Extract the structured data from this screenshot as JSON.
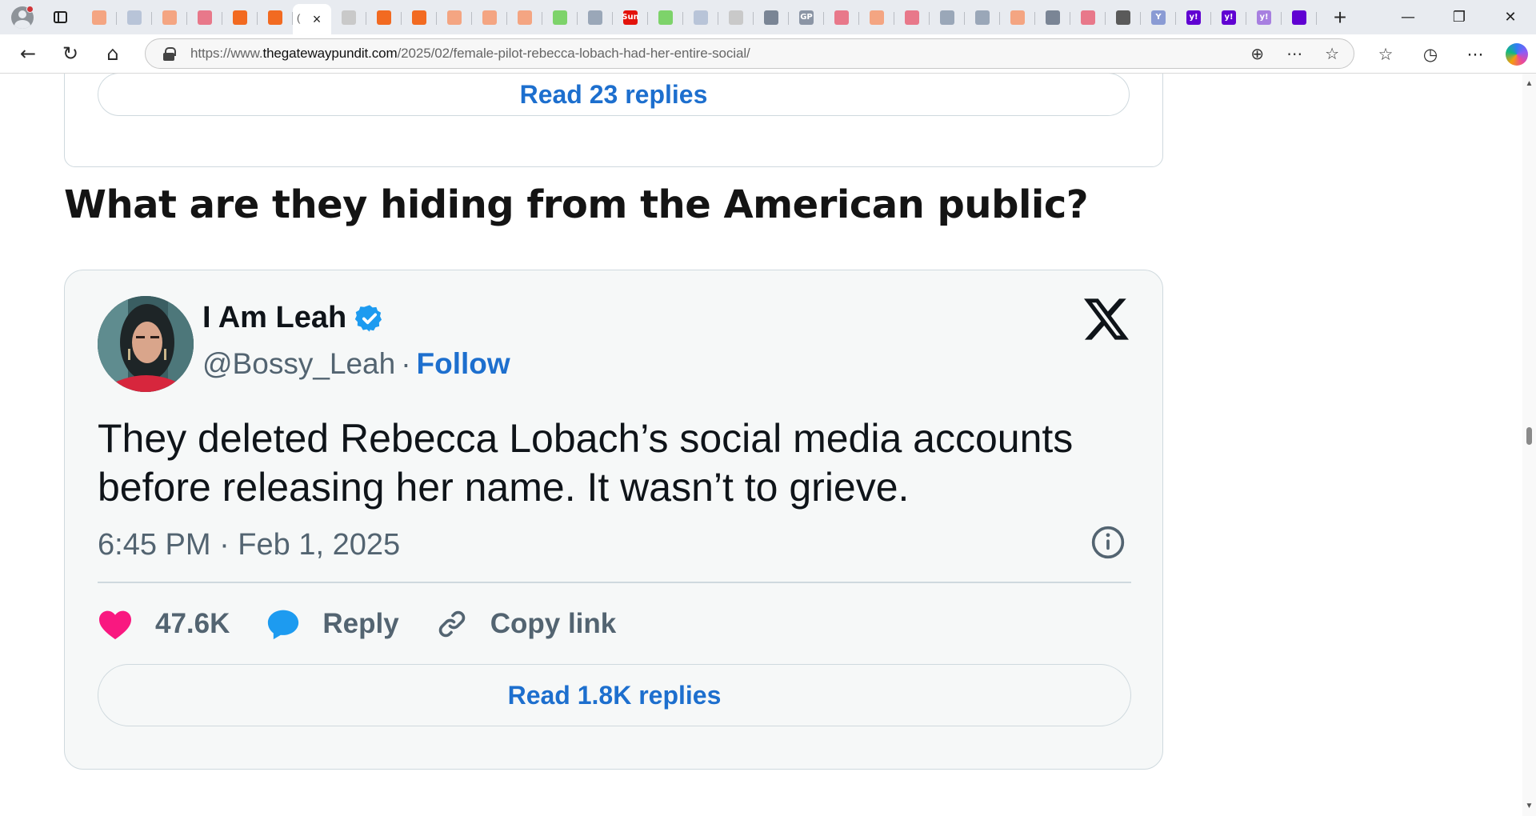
{
  "window": {
    "tab_close": "×",
    "tab_prefix": "(",
    "new_tab": "+",
    "minimize": "—",
    "restore": "❐",
    "close": "✕"
  },
  "tabs": [
    {
      "icon": "bookmark-icon",
      "color": "#f4a582"
    },
    {
      "icon": "world-icon",
      "color": "#b8c4d8"
    },
    {
      "icon": "bookmark-icon",
      "color": "#f4a582"
    },
    {
      "icon": "youtube-icon",
      "color": "#e8788a"
    },
    {
      "icon": "bookmark-icon",
      "color": "#f26a21"
    },
    {
      "icon": "bookmark-icon",
      "color": "#f26a21"
    },
    {
      "icon": "document-icon",
      "color": "#c9c9c9"
    },
    {
      "icon": "bookmark-icon",
      "color": "#f26a21"
    },
    {
      "icon": "bookmark-icon",
      "color": "#f26a21"
    },
    {
      "icon": "bookmark-icon",
      "color": "#f4a582"
    },
    {
      "icon": "bookmark-icon",
      "color": "#f4a582"
    },
    {
      "icon": "bookmark-icon",
      "color": "#f4a582"
    },
    {
      "icon": "play-icon",
      "color": "#7dd36a"
    },
    {
      "icon": "search-icon",
      "color": "#9aa7b8"
    },
    {
      "icon": "sun-icon",
      "color": "#e3120b",
      "text": "Sun"
    },
    {
      "icon": "play-icon",
      "color": "#7dd36a"
    },
    {
      "icon": "world-icon",
      "color": "#b8c4d8"
    },
    {
      "icon": "document-icon",
      "color": "#c9c9c9"
    },
    {
      "icon": "news-icon",
      "color": "#7a8595"
    },
    {
      "icon": "gp-icon",
      "color": "#8b95a5",
      "text": "GP"
    },
    {
      "icon": "youtube-icon",
      "color": "#e8788a"
    },
    {
      "icon": "bookmark-icon",
      "color": "#f4a582"
    },
    {
      "icon": "youtube-icon",
      "color": "#e8788a"
    },
    {
      "icon": "puzzle-icon",
      "color": "#9aa7b8"
    },
    {
      "icon": "search-icon",
      "color": "#9aa7b8"
    },
    {
      "icon": "bookmark-icon",
      "color": "#f4a582"
    },
    {
      "icon": "circle-icon",
      "color": "#7a8595"
    },
    {
      "icon": "youtube-icon",
      "color": "#e8788a"
    },
    {
      "icon": "circle-icon",
      "color": "#5a5a5a"
    },
    {
      "icon": "y-icon",
      "color": "#8a9bd4",
      "text": "Y"
    },
    {
      "icon": "yahoo-icon",
      "color": "#6001d2",
      "text": "y!"
    },
    {
      "icon": "yahoo-icon",
      "color": "#6001d2",
      "text": "y!"
    },
    {
      "icon": "yahoo-icon",
      "color": "#a77fe0",
      "text": "y!"
    },
    {
      "icon": "mail-icon",
      "color": "#6001d2"
    }
  ],
  "address_bar": {
    "scheme": "https://www.",
    "host": "thegatewaypundit.com",
    "path": "/2025/02/female-pilot-rebecca-lobach-had-her-entire-social/"
  },
  "nav": {
    "back": "←",
    "refresh": "↻",
    "home": "⌂"
  },
  "addr_tools": {
    "zoom": "⊕",
    "reading": "⋯",
    "favorite": "☆"
  },
  "right_tools": {
    "favorites": "☆",
    "history": "◷",
    "more": "⋯"
  },
  "previous_embed": {
    "read_replies": "Read 23 replies"
  },
  "article": {
    "heading": "What are they hiding from the American public?"
  },
  "tweet": {
    "author_name": "I Am Leah",
    "handle": "@Bossy_Leah",
    "separator": "·",
    "follow_label": "Follow",
    "text": "They deleted Rebecca Lobach’s social media accounts before releasing her name. It wasn’t to grieve.",
    "timestamp": "6:45 PM · Feb 1, 2025",
    "likes": "47.6K",
    "reply_label": "Reply",
    "copy_link_label": "Copy link",
    "read_replies": "Read 1.8K replies"
  },
  "colors": {
    "link_blue": "#1d6fce",
    "verified_blue": "#1d9bf0",
    "like_pink": "#f91880",
    "reply_blue": "#1d9bf0",
    "text_dark": "#0f1419",
    "text_gray": "#536471"
  }
}
